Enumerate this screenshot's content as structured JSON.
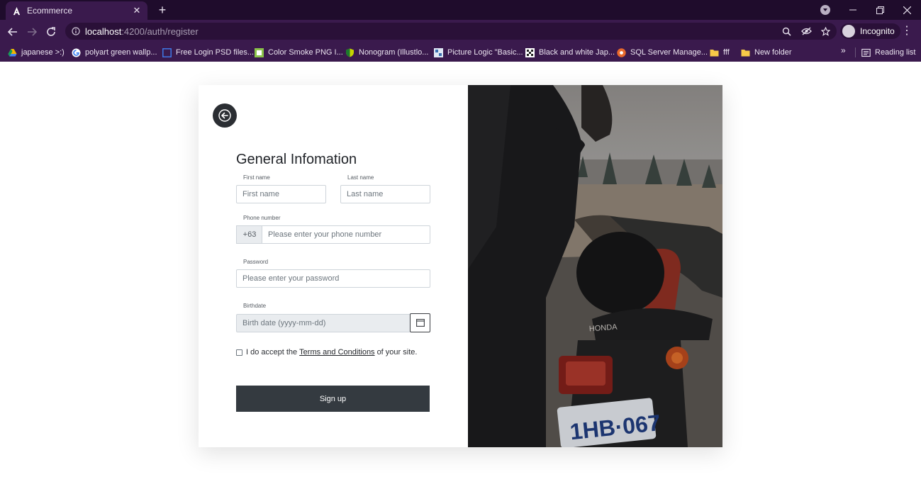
{
  "browser": {
    "tab_title": "Ecommerce",
    "url_host": "localhost",
    "url_rest": ":4200/auth/register",
    "profile_label": "Incognito",
    "bookmarks": [
      {
        "label": "japanese >:)",
        "icon": "drive-icon"
      },
      {
        "label": "polyart green wallp...",
        "icon": "google-icon"
      },
      {
        "label": "Free Login PSD files...",
        "icon": "square-outline-icon"
      },
      {
        "label": "Color Smoke PNG I...",
        "icon": "green-box-icon"
      },
      {
        "label": "Nonogram (Illustlo...",
        "icon": "shield-icon"
      },
      {
        "label": "Picture Logic \"Basic...",
        "icon": "picture-icon"
      },
      {
        "label": "Black and white Jap...",
        "icon": "grid-icon"
      },
      {
        "label": "SQL Server Manage...",
        "icon": "orange-circle-icon"
      },
      {
        "label": "fff",
        "icon": "folder-icon"
      },
      {
        "label": "New folder",
        "icon": "folder-icon"
      }
    ],
    "more_label": "»",
    "reading_list_label": "Reading list"
  },
  "form": {
    "title": "General Infomation",
    "first_name": {
      "label": "First name",
      "placeholder": "First name"
    },
    "last_name": {
      "label": "Last name",
      "placeholder": "Last name"
    },
    "phone": {
      "label": "Phone number",
      "prefix": "+63",
      "placeholder": "Please enter your phone number"
    },
    "password": {
      "label": "Password",
      "placeholder": "Please enter your password"
    },
    "birthdate": {
      "label": "Birthdate",
      "placeholder": "Birth date (yyyy-mm-dd)"
    },
    "terms": {
      "before": "I do accept the",
      "link": "Terms and Conditions",
      "after": "of your site."
    },
    "submit_label": "Sign up"
  },
  "colors": {
    "accent_dark": "#343a40",
    "chrome_bg": "#3a1a4d"
  }
}
